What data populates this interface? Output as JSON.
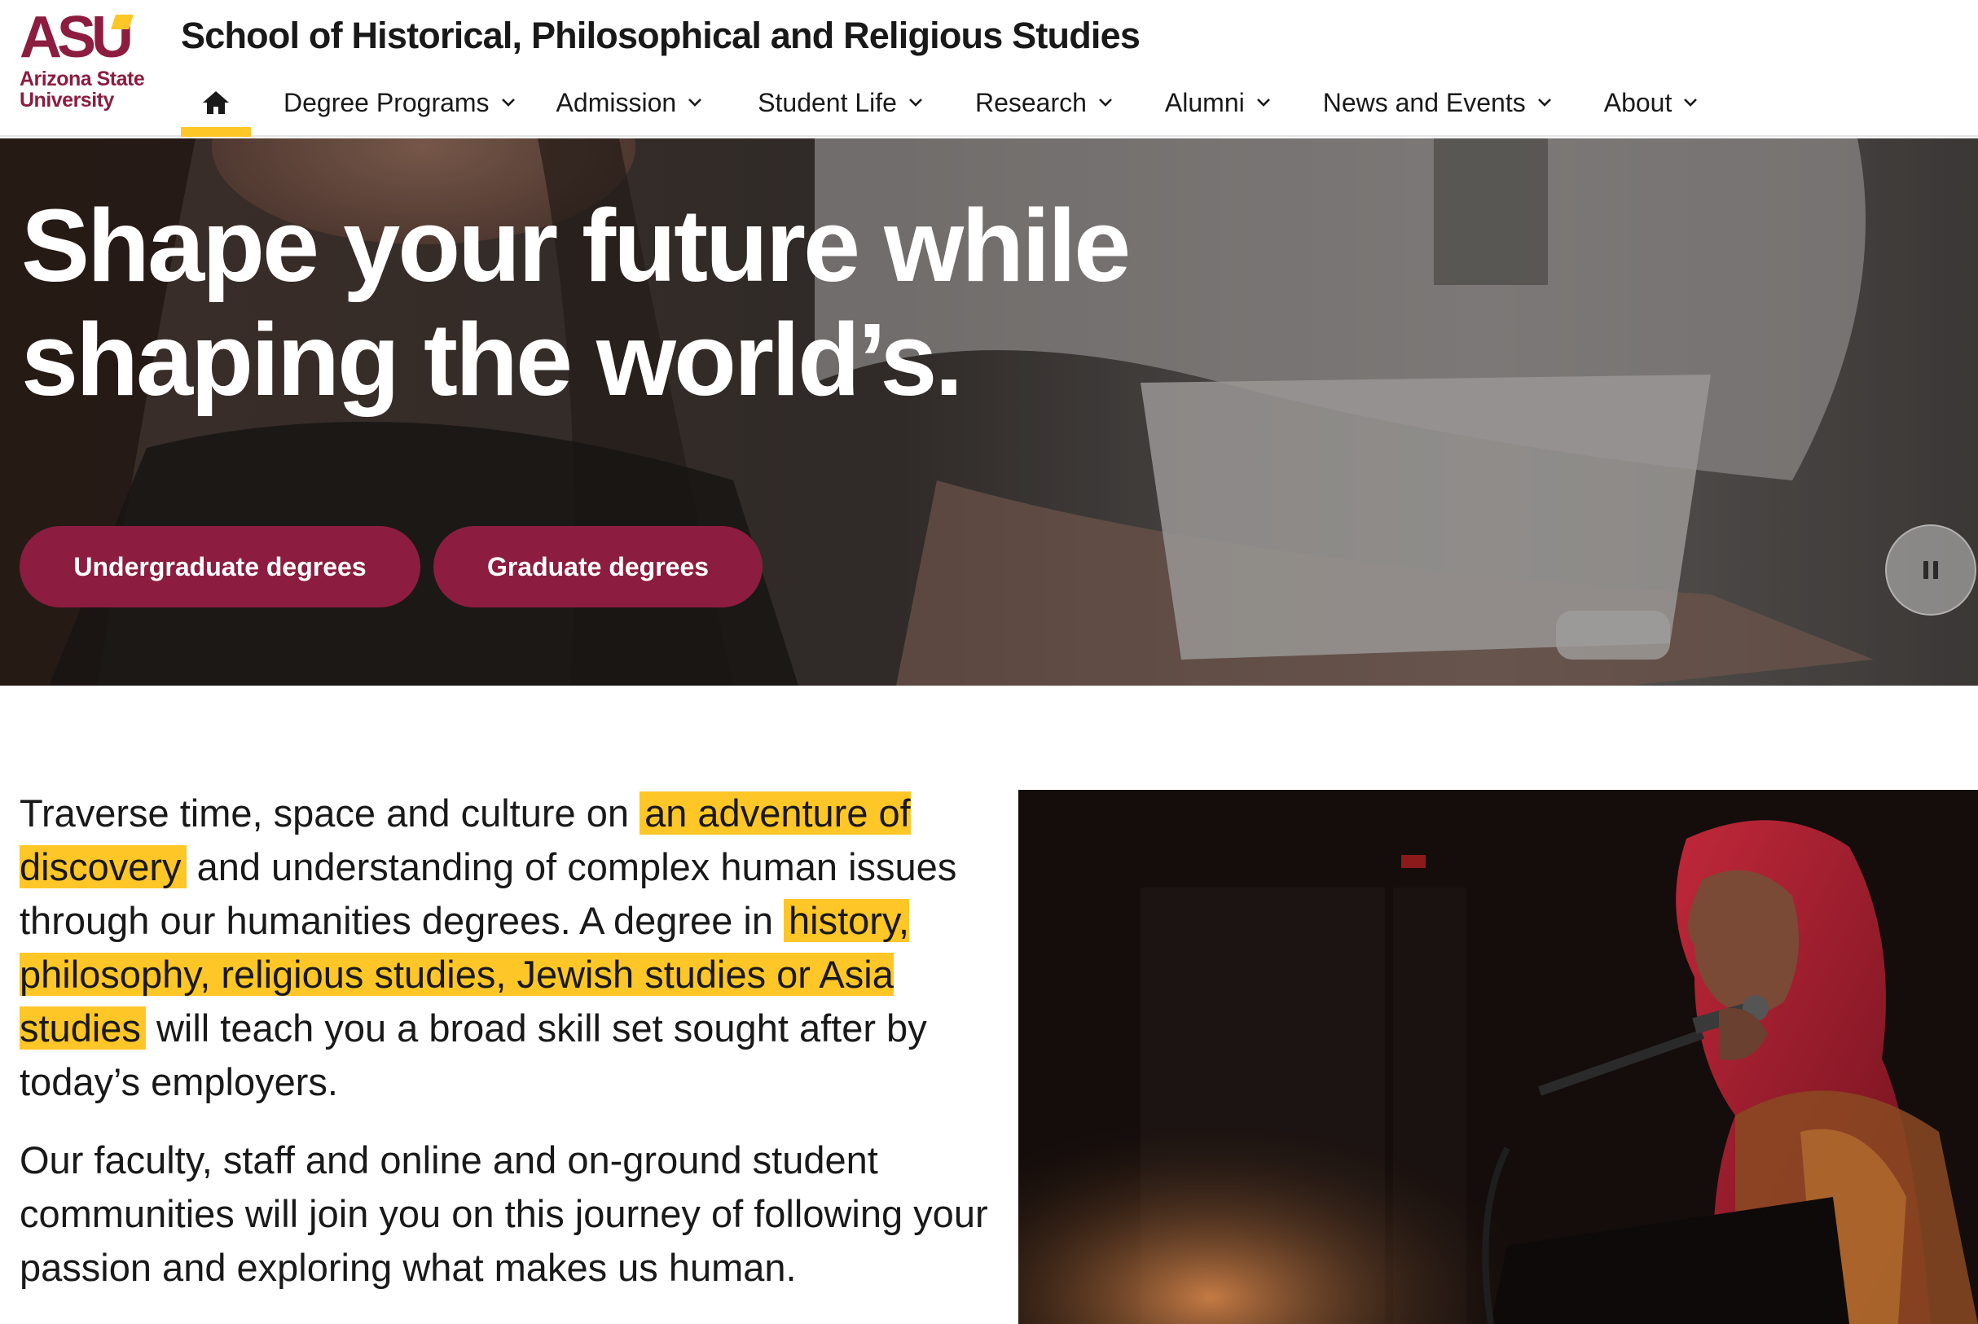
{
  "brand": {
    "logo_mark": "ASU",
    "logo_line1": "Arizona State",
    "logo_line2": "University",
    "maroon": "#8c1d40",
    "gold": "#ffc627"
  },
  "header": {
    "site_title": "School of Historical, Philosophical and Religious Studies"
  },
  "nav": {
    "home_icon": "home-icon",
    "items": [
      {
        "label": "Degree Programs"
      },
      {
        "label": "Admission"
      },
      {
        "label": "Student Life"
      },
      {
        "label": "Research"
      },
      {
        "label": "Alumni"
      },
      {
        "label": "News and Events"
      },
      {
        "label": "About"
      }
    ]
  },
  "hero": {
    "title_line1": "Shape your future while",
    "title_line2": "shaping the world’s.",
    "buttons": [
      {
        "label": "Undergraduate degrees"
      },
      {
        "label": "Graduate degrees"
      }
    ],
    "pause_icon": "pause-icon"
  },
  "intro": {
    "p1_a": "Traverse time, space and culture on ",
    "p1_hl1": "an adventure of discovery",
    "p1_b": " and understanding of complex human issues through our humanities degrees. A degree in ",
    "p1_hl2": "history, philosophy, religious studies, Jewish studies or Asia studies",
    "p1_c": " will teach you a broad skill set sought after by today’s employers.",
    "p2": "Our faculty, staff and online and on-ground student communities will join you on this journey of following your passion and exploring what makes us human."
  }
}
